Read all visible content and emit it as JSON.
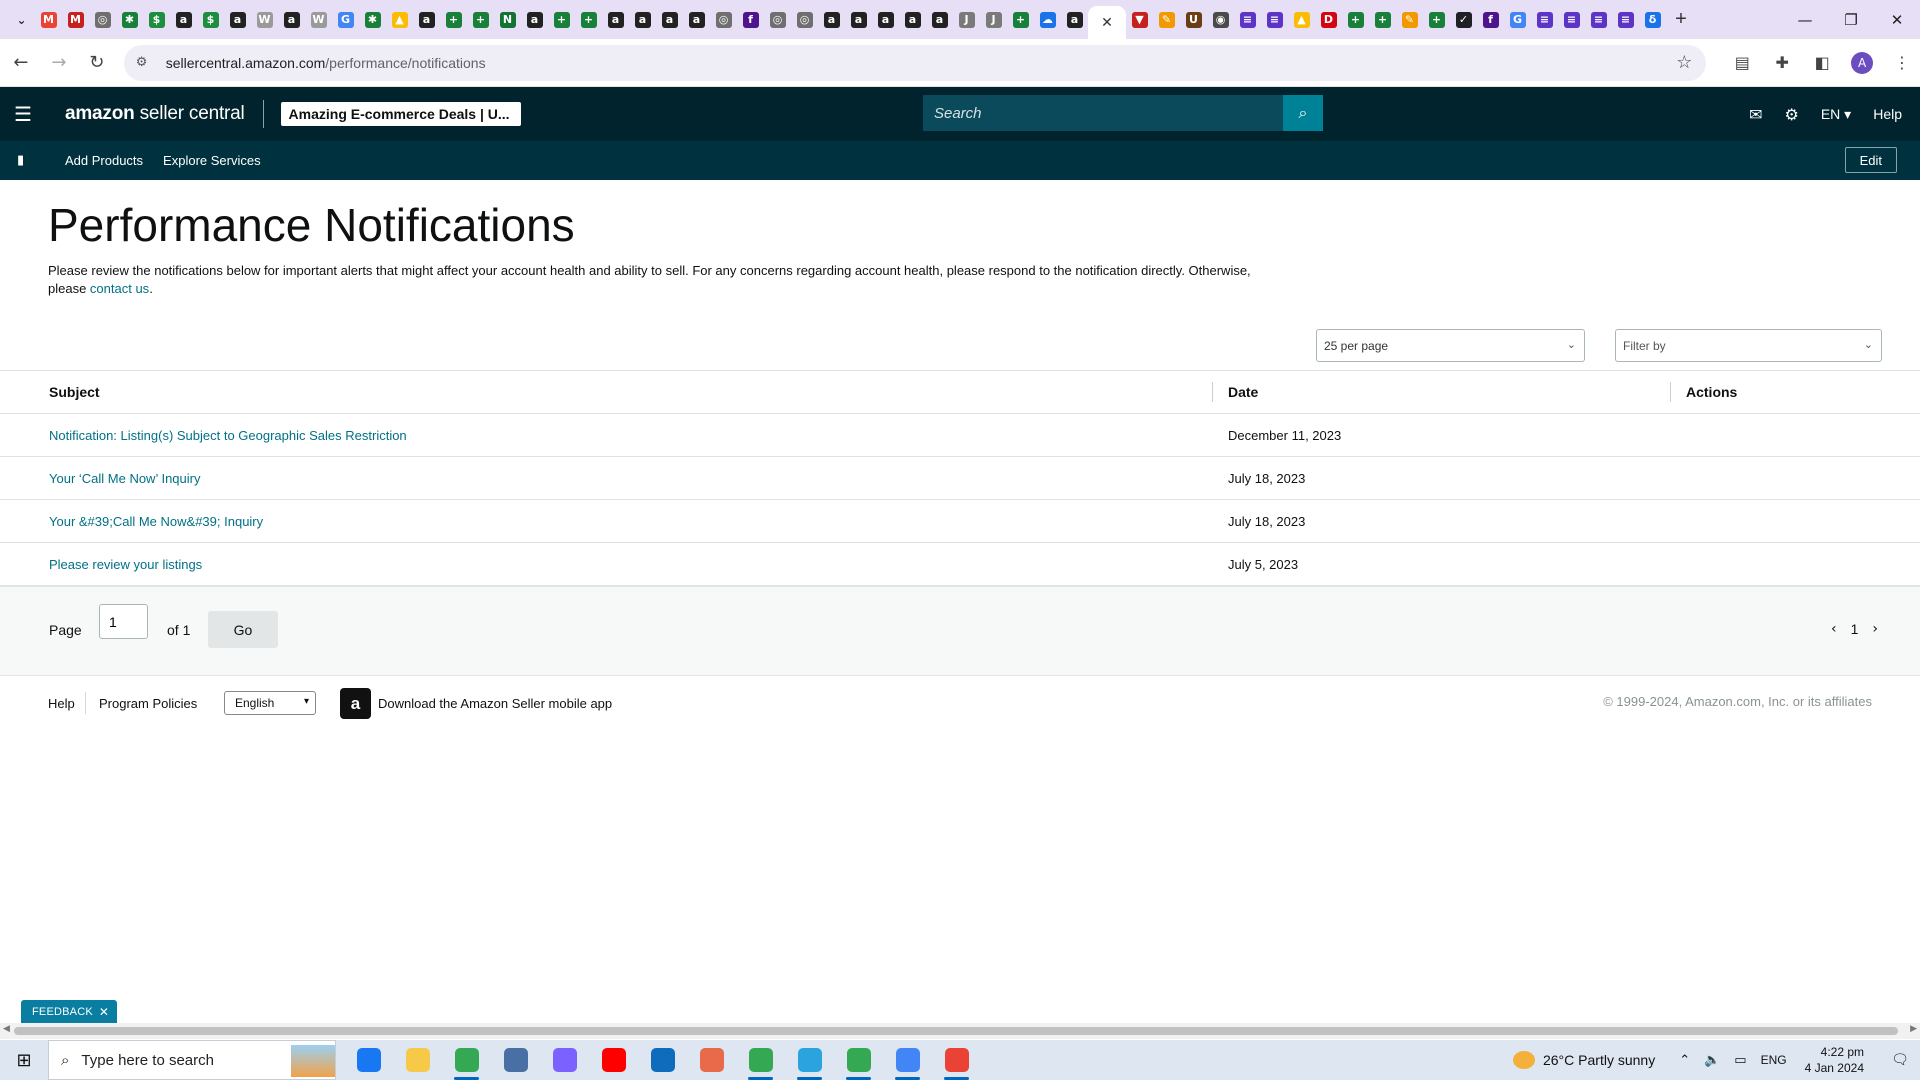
{
  "browser": {
    "tab_favicons": [
      {
        "icon": "gmail-icon",
        "color": "#ea4335",
        "glyph": "M"
      },
      {
        "icon": "gmail-icon",
        "color": "#c5221f",
        "glyph": "M"
      },
      {
        "icon": "globe-icon",
        "color": "#6f6f6f",
        "glyph": "◎"
      },
      {
        "icon": "puzzle-icon",
        "color": "#188038",
        "glyph": "✱"
      },
      {
        "icon": "dollar-icon",
        "color": "#1e8e3e",
        "glyph": "$"
      },
      {
        "icon": "amazon-icon",
        "color": "#222222",
        "glyph": "a"
      },
      {
        "icon": "dollar-icon",
        "color": "#1e8e3e",
        "glyph": "$"
      },
      {
        "icon": "amazon-icon",
        "color": "#222222",
        "glyph": "a"
      },
      {
        "icon": "wix-icon",
        "color": "#9a9a9a",
        "glyph": "W"
      },
      {
        "icon": "amazon-icon",
        "color": "#222222",
        "glyph": "a"
      },
      {
        "icon": "wix-icon",
        "color": "#9a9a9a",
        "glyph": "W"
      },
      {
        "icon": "google-icon",
        "color": "#4285f4",
        "glyph": "G"
      },
      {
        "icon": "puzzle-icon",
        "color": "#188038",
        "glyph": "✱"
      },
      {
        "icon": "drive-icon",
        "color": "#fbbc04",
        "glyph": "▲"
      },
      {
        "icon": "amazon-icon",
        "color": "#222222",
        "glyph": "a"
      },
      {
        "icon": "sheets-icon",
        "color": "#188038",
        "glyph": "+"
      },
      {
        "icon": "sheets-icon",
        "color": "#188038",
        "glyph": "+"
      },
      {
        "icon": "script-icon",
        "color": "#137333",
        "glyph": "N"
      },
      {
        "icon": "amazon-icon",
        "color": "#222222",
        "glyph": "a"
      },
      {
        "icon": "sheets-icon",
        "color": "#188038",
        "glyph": "+"
      },
      {
        "icon": "sheets-icon",
        "color": "#188038",
        "glyph": "+"
      },
      {
        "icon": "amazon-icon",
        "color": "#222222",
        "glyph": "a"
      },
      {
        "icon": "amazon-icon",
        "color": "#222222",
        "glyph": "a"
      },
      {
        "icon": "amazon-icon",
        "color": "#222222",
        "glyph": "a"
      },
      {
        "icon": "amazon-icon",
        "color": "#222222",
        "glyph": "a"
      },
      {
        "icon": "globe-icon",
        "color": "#6f6f6f",
        "glyph": "◎"
      },
      {
        "icon": "fedex-icon",
        "color": "#4d148c",
        "glyph": "f"
      },
      {
        "icon": "globe-icon",
        "color": "#6f6f6f",
        "glyph": "◎"
      },
      {
        "icon": "globe-icon",
        "color": "#6f6f6f",
        "glyph": "◎"
      },
      {
        "icon": "amazon-icon",
        "color": "#222222",
        "glyph": "a"
      },
      {
        "icon": "amazon-icon",
        "color": "#222222",
        "glyph": "a"
      },
      {
        "icon": "amazon-icon",
        "color": "#222222",
        "glyph": "a"
      },
      {
        "icon": "amazon-icon",
        "color": "#222222",
        "glyph": "a"
      },
      {
        "icon": "amazon-icon",
        "color": "#222222",
        "glyph": "a"
      },
      {
        "icon": "script-icon",
        "color": "#7a7a7a",
        "glyph": "J"
      },
      {
        "icon": "script-icon",
        "color": "#7a7a7a",
        "glyph": "J"
      },
      {
        "icon": "sheets-icon",
        "color": "#188038",
        "glyph": "+"
      },
      {
        "icon": "cloud-icon",
        "color": "#1a73e8",
        "glyph": "☁"
      },
      {
        "icon": "amazon-icon",
        "color": "#222222",
        "glyph": "a"
      }
    ],
    "tab_favicons_after": [
      {
        "icon": "shield-icon",
        "color": "#c5221f",
        "glyph": "▼"
      },
      {
        "icon": "pen-icon",
        "color": "#f29900",
        "glyph": "✎"
      },
      {
        "icon": "ups-icon",
        "color": "#6b3d15",
        "glyph": "U"
      },
      {
        "icon": "usps-icon",
        "color": "#4a4a4a",
        "glyph": "◉"
      },
      {
        "icon": "forms-icon",
        "color": "#5c35c6",
        "glyph": "≡"
      },
      {
        "icon": "forms-icon",
        "color": "#5c35c6",
        "glyph": "≡"
      },
      {
        "icon": "drive-icon",
        "color": "#fbbc04",
        "glyph": "▲"
      },
      {
        "icon": "dhl-icon",
        "color": "#d40511",
        "glyph": "D"
      },
      {
        "icon": "sheets-icon",
        "color": "#188038",
        "glyph": "+"
      },
      {
        "icon": "sheets-icon",
        "color": "#188038",
        "glyph": "+"
      },
      {
        "icon": "pen-icon",
        "color": "#f29900",
        "glyph": "✎"
      },
      {
        "icon": "sheets-icon",
        "color": "#188038",
        "glyph": "+"
      },
      {
        "icon": "check-icon",
        "color": "#202124",
        "glyph": "✓"
      },
      {
        "icon": "fedex-icon",
        "color": "#4d148c",
        "glyph": "f"
      },
      {
        "icon": "google-icon",
        "color": "#4285f4",
        "glyph": "G"
      },
      {
        "icon": "forms-icon",
        "color": "#5c35c6",
        "glyph": "≡"
      },
      {
        "icon": "forms-icon",
        "color": "#5c35c6",
        "glyph": "≡"
      },
      {
        "icon": "forms-icon",
        "color": "#5c35c6",
        "glyph": "≡"
      },
      {
        "icon": "forms-icon",
        "color": "#5c35c6",
        "glyph": "≡"
      },
      {
        "icon": "flow-icon",
        "color": "#1a73e8",
        "glyph": "δ"
      }
    ],
    "url_host": "sellercentral.amazon.com",
    "url_path": "/performance/notifications",
    "profile_initial": "A"
  },
  "header": {
    "logo_amazon": "amazon",
    "logo_rest": " seller central",
    "store_name": "Amazing E-commerce Deals | U...",
    "search_placeholder": "Search",
    "lang": "EN",
    "help": "Help"
  },
  "subnav": {
    "items": [
      "Add Products",
      "Explore Services"
    ],
    "edit": "Edit"
  },
  "page": {
    "title": "Performance Notifications",
    "intro": "Please review the notifications below for important alerts that might affect your account health and ability to sell. For any concerns regarding account health, please respond to the notification directly. Otherwise, please ",
    "contact_link": "contact us",
    "intro_end": ".",
    "per_page": "25 per page",
    "filter_placeholder": "Filter by"
  },
  "table": {
    "headers": {
      "subject": "Subject",
      "date": "Date",
      "actions": "Actions"
    },
    "rows": [
      {
        "subject": "Notification: Listing(s) Subject to Geographic Sales Restriction",
        "date": "December 11, 2023"
      },
      {
        "subject": "Your ‘Call Me Now’ Inquiry",
        "date": "July 18, 2023"
      },
      {
        "subject": "Your &#39;Call Me Now&#39; Inquiry",
        "date": "July 18, 2023"
      },
      {
        "subject": "Please review your listings",
        "date": "July 5, 2023"
      }
    ]
  },
  "pagination": {
    "page_label": "Page",
    "page_value": "1",
    "of_label": "of 1",
    "go": "Go",
    "current": "1"
  },
  "footer": {
    "help": "Help",
    "policies": "Program Policies",
    "language": "English",
    "app_text": "Download the Amazon Seller mobile app",
    "copyright": "© 1999-2024, Amazon.com, Inc. or its affiliates"
  },
  "feedback": "FEEDBACK",
  "taskbar": {
    "search_text": "Type here to search",
    "apps": [
      {
        "name": "facebook",
        "color": "#1877f2",
        "running": false
      },
      {
        "name": "file-explorer",
        "color": "#f7c948",
        "running": false
      },
      {
        "name": "chrome",
        "color": "#34a853",
        "running": true
      },
      {
        "name": "calculator",
        "color": "#4a6fa5",
        "running": false
      },
      {
        "name": "copilot",
        "color": "#7b61ff",
        "running": false
      },
      {
        "name": "youtube",
        "color": "#ff0000",
        "running": false
      },
      {
        "name": "store",
        "color": "#0f6cbd",
        "running": false
      },
      {
        "name": "snipping-tool",
        "color": "#e86a4a",
        "running": false
      },
      {
        "name": "chrome-profile",
        "color": "#34a853",
        "running": true
      },
      {
        "name": "telegram",
        "color": "#2aa3df",
        "running": true
      },
      {
        "name": "chrome-profile",
        "color": "#34a853",
        "running": true
      },
      {
        "name": "chrome-profile",
        "color": "#4285f4",
        "running": true
      },
      {
        "name": "chrome-profile",
        "color": "#ea4335",
        "running": true
      }
    ],
    "weather": "26°C  Partly sunny",
    "lang": "ENG",
    "time": "4:22 pm",
    "date": "4 Jan 2024"
  }
}
